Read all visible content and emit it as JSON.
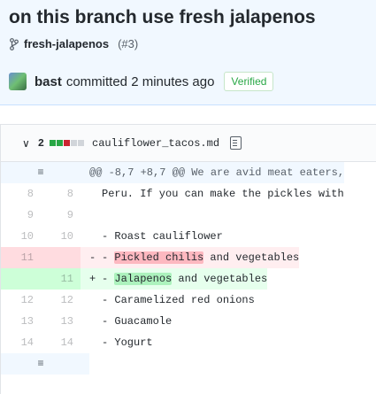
{
  "commit": {
    "title": "on this branch use fresh jalapenos",
    "branch_name": "fresh-jalapenos",
    "pr_ref": "(#3)",
    "author": "bast",
    "action": "committed 2 minutes ago",
    "badge": "Verified"
  },
  "file": {
    "changes_count": "2",
    "name": "cauliflower_tacos.md",
    "change_blocks": [
      "#28a745",
      "#28a745",
      "#cb2431",
      "#d1d5da",
      "#d1d5da"
    ]
  },
  "diff": {
    "hunk": "@@ -8,7 +8,7 @@ We are avid meat eaters,",
    "lines": [
      {
        "old": "8",
        "new": "8",
        "mark": "",
        "code": "Peru. If you can make the pickles with"
      },
      {
        "old": "9",
        "new": "9",
        "mark": "",
        "code": ""
      },
      {
        "old": "10",
        "new": "10",
        "mark": "",
        "code": "- Roast cauliflower"
      }
    ],
    "deleted": {
      "old": "11",
      "mark": "-",
      "prefix": "- ",
      "highlight": "Pickled chilis",
      "rest": " and vegetables"
    },
    "added": {
      "new": "11",
      "mark": "+",
      "prefix": "- ",
      "highlight": "Jalapenos",
      "rest": " and vegetables"
    },
    "after": [
      {
        "old": "12",
        "new": "12",
        "code": "- Caramelized red onions"
      },
      {
        "old": "13",
        "new": "13",
        "code": "- Guacamole"
      },
      {
        "old": "14",
        "new": "14",
        "code": "- Yogurt"
      }
    ]
  }
}
